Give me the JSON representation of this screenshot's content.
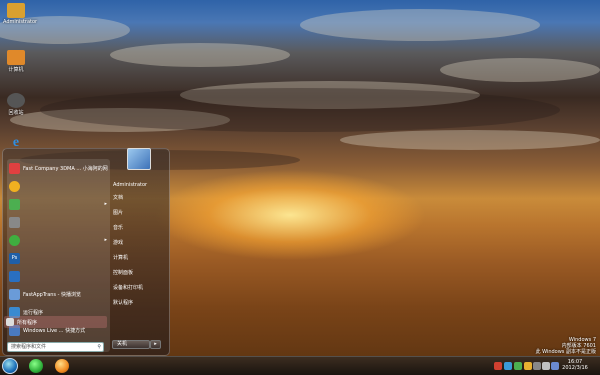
{
  "desktop": {
    "icons": [
      {
        "label": "Administrator",
        "icon": "folder-icon",
        "color": "#d9a030"
      },
      {
        "label": "计算机",
        "icon": "computer-icon",
        "color": "#e0892a"
      },
      {
        "label": "回收站",
        "icon": "recycle-bin-icon",
        "color": "#555555"
      },
      {
        "label": "",
        "icon": "internet-explorer-icon",
        "color": "#2f8ee0"
      }
    ]
  },
  "start_menu": {
    "programs": [
      {
        "label": "Fast Company 3DMA ... 小海阿的网",
        "color": "#e04040",
        "arrow": ""
      },
      {
        "label": "",
        "color": "#f0b020",
        "arrow": ""
      },
      {
        "label": "",
        "color": "#4caf50",
        "arrow": "▸"
      },
      {
        "label": "",
        "color": "#888888",
        "arrow": ""
      },
      {
        "label": "",
        "color": "#3fae3f",
        "arrow": "▸"
      },
      {
        "label": "Ps",
        "color": "#1f5fa8",
        "arrow": ""
      },
      {
        "label": "",
        "color": "#2a6fc0",
        "arrow": ""
      },
      {
        "label": "FastAppTrans - 快播浏览",
        "color": "#6a9bd8",
        "arrow": ""
      },
      {
        "label": "运行程序",
        "color": "#3a8ad0",
        "arrow": ""
      },
      {
        "label": "Windows Live ... 快捷方式",
        "color": "#4a7ac0",
        "arrow": ""
      }
    ],
    "all_programs_label": "所有程序",
    "search_placeholder": "搜索程序和文件",
    "right_items": [
      "Administrator",
      "文档",
      "图片",
      "音乐",
      "游戏",
      "计算机",
      "控制面板",
      "设备和打印机",
      "默认程序"
    ],
    "shutdown_label": "关机",
    "shutdown_arrow": "▸"
  },
  "taskbar": {
    "apps": [
      {
        "name": "360-browser-icon",
        "color": "#2fae3a"
      },
      {
        "name": "orange-app-icon",
        "color": "#f08a20"
      }
    ],
    "tray": [
      "#d04030",
      "#3a9ad8",
      "#4caf50",
      "#e8b030",
      "#888888",
      "#c0c0c0",
      "#6a8ad0",
      "#999999"
    ],
    "time": "16:07",
    "date": "2012/3/16"
  },
  "watermark": {
    "line1": "Windows 7",
    "line2": "内部版本 7601",
    "line3": "此 Windows 副本不是正版"
  }
}
